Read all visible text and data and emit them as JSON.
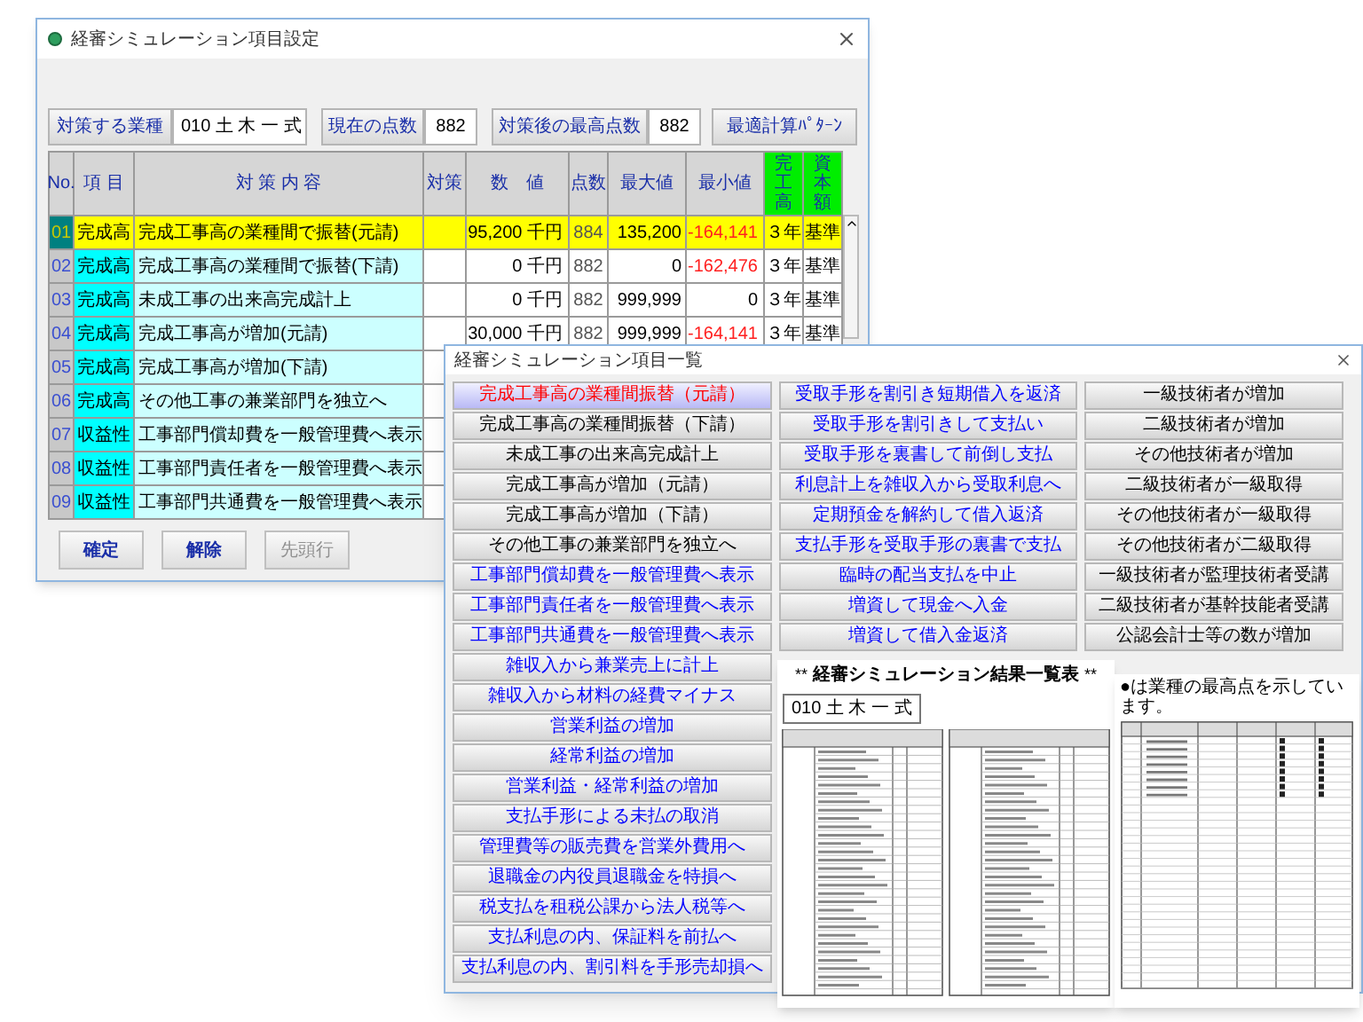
{
  "main_window": {
    "title": "経審シミュレーション項目設定",
    "toolbar": {
      "industry_label": "対策する業種",
      "industry_value": "010 土 木 一 式",
      "current_label": "現在の点数",
      "current_value": "882",
      "best_label": "対策後の最高点数",
      "best_value": "882",
      "pattern_button": "最適計算ﾊﾟﾀｰﾝ"
    },
    "columns": [
      {
        "label": "No.",
        "highlight": false
      },
      {
        "label": "項 目",
        "highlight": false
      },
      {
        "label": "対 策 内 容",
        "highlight": false
      },
      {
        "label": "対策",
        "highlight": false
      },
      {
        "label": "数　値",
        "highlight": false
      },
      {
        "label": "点数",
        "highlight": false
      },
      {
        "label": "最大値",
        "highlight": false
      },
      {
        "label": "最小値",
        "highlight": false
      },
      {
        "label": "完工高",
        "highlight": true
      },
      {
        "label": "資本額",
        "highlight": true
      }
    ],
    "rows": [
      {
        "no": "01",
        "category": "完成高",
        "measure": "完成工事高の業種間で振替(元請)",
        "value": "95,200 千円",
        "points": "884",
        "max": "135,200",
        "min": "-164,141",
        "min_alert": true,
        "years": "３年",
        "basis": "基準",
        "selected": true
      },
      {
        "no": "02",
        "category": "完成高",
        "measure": "完成工事高の業種間で振替(下請)",
        "value": "0 千円",
        "points": "882",
        "max": "0",
        "min": "-162,476",
        "min_alert": true,
        "years": "３年",
        "basis": "基準",
        "selected": false
      },
      {
        "no": "03",
        "category": "完成高",
        "measure": "未成工事の出来高完成計上",
        "value": "0 千円",
        "points": "882",
        "max": "999,999",
        "min": "0",
        "min_alert": false,
        "years": "３年",
        "basis": "基準",
        "selected": false
      },
      {
        "no": "04",
        "category": "完成高",
        "measure": "完成工事高が増加(元請)",
        "value": "30,000 千円",
        "points": "882",
        "max": "999,999",
        "min": "-164,141",
        "min_alert": true,
        "years": "３年",
        "basis": "基準",
        "selected": false
      },
      {
        "no": "05",
        "category": "完成高",
        "measure": "完成工事高が増加(下請)",
        "selected": false
      },
      {
        "no": "06",
        "category": "完成高",
        "measure": "その他工事の兼業部門を独立へ",
        "selected": false
      },
      {
        "no": "07",
        "category": "収益性",
        "measure": "工事部門償却費を一般管理費へ表示",
        "selected": false
      },
      {
        "no": "08",
        "category": "収益性",
        "measure": "工事部門責任者を一般管理費へ表示",
        "selected": false
      },
      {
        "no": "09",
        "category": "収益性",
        "measure": "工事部門共通費を一般管理費へ表示",
        "selected": false
      }
    ],
    "buttons": [
      {
        "label": "確定",
        "disabled": false
      },
      {
        "label": "解除",
        "disabled": false
      },
      {
        "label": "先頭行",
        "disabled": true
      }
    ]
  },
  "list_window": {
    "title": "経審シミュレーション項目一覧",
    "columns": [
      [
        {
          "label": "完成工事高の業種間振替（元請）",
          "color": "#ff0000",
          "selected": true
        },
        {
          "label": "完成工事高の業種間振替（下請）",
          "color": "#000000",
          "selected": false
        },
        {
          "label": "未成工事の出来高完成計上",
          "color": "#000000",
          "selected": false
        },
        {
          "label": "完成工事高が増加（元請）",
          "color": "#000000",
          "selected": false
        },
        {
          "label": "完成工事高が増加（下請）",
          "color": "#000000",
          "selected": false
        },
        {
          "label": "その他工事の兼業部門を独立へ",
          "color": "#000000",
          "selected": false
        },
        {
          "label": "工事部門償却費を一般管理費へ表示",
          "color": "#0000ff",
          "selected": false
        },
        {
          "label": "工事部門責任者を一般管理費へ表示",
          "color": "#0000ff",
          "selected": false
        },
        {
          "label": "工事部門共通費を一般管理費へ表示",
          "color": "#0000ff",
          "selected": false
        },
        {
          "label": "雑収入から兼業売上に計上",
          "color": "#0000ff",
          "selected": false
        },
        {
          "label": "雑収入から材料の経費マイナス",
          "color": "#0000ff",
          "selected": false
        },
        {
          "label": "営業利益の増加",
          "color": "#0000ff",
          "selected": false
        },
        {
          "label": "経常利益の増加",
          "color": "#0000ff",
          "selected": false
        },
        {
          "label": "営業利益・経常利益の増加",
          "color": "#0000ff",
          "selected": false
        },
        {
          "label": "支払手形による未払の取消",
          "color": "#0000ff",
          "selected": false
        },
        {
          "label": "管理費等の販売費を営業外費用へ",
          "color": "#0000ff",
          "selected": false
        },
        {
          "label": "退職金の内役員退職金を特損へ",
          "color": "#0000ff",
          "selected": false
        },
        {
          "label": "税支払を租税公課から法人税等へ",
          "color": "#0000ff",
          "selected": false
        },
        {
          "label": "支払利息の内、保証料を前払へ",
          "color": "#0000ff",
          "selected": false
        },
        {
          "label": "支払利息の内、割引料を手形売却損へ",
          "color": "#0000ff",
          "selected": false
        }
      ],
      [
        {
          "label": "受取手形を割引き短期借入を返済",
          "color": "#0000ff",
          "selected": false
        },
        {
          "label": "受取手形を割引きして支払い",
          "color": "#0000ff",
          "selected": false
        },
        {
          "label": "受取手形を裏書して前倒し支払",
          "color": "#0000ff",
          "selected": false
        },
        {
          "label": "利息計上を雑収入から受取利息へ",
          "color": "#0000ff",
          "selected": false
        },
        {
          "label": "定期預金を解約して借入返済",
          "color": "#0000ff",
          "selected": false
        },
        {
          "label": "支払手形を受取手形の裏書で支払",
          "color": "#0000ff",
          "selected": false
        },
        {
          "label": "臨時の配当支払を中止",
          "color": "#0000ff",
          "selected": false
        },
        {
          "label": "増資して現金へ入金",
          "color": "#0000ff",
          "selected": false
        },
        {
          "label": "増資して借入金返済",
          "color": "#0000ff",
          "selected": false
        }
      ],
      [
        {
          "label": "一級技術者が増加",
          "color": "#000000",
          "selected": false
        },
        {
          "label": "二級技術者が増加",
          "color": "#000000",
          "selected": false
        },
        {
          "label": "その他技術者が増加",
          "color": "#000000",
          "selected": false
        },
        {
          "label": "二級技術者が一級取得",
          "color": "#000000",
          "selected": false
        },
        {
          "label": "その他技術者が一級取得",
          "color": "#000000",
          "selected": false
        },
        {
          "label": "その他技術者が二級取得",
          "color": "#000000",
          "selected": false
        },
        {
          "label": "一級技術者が監理技術者受講",
          "color": "#000000",
          "selected": false
        },
        {
          "label": "二級技術者が基幹技能者受講",
          "color": "#000000",
          "selected": false
        },
        {
          "label": "公認会計士等の数が増加",
          "color": "#000000",
          "selected": false
        }
      ]
    ]
  },
  "report": {
    "mark_left": "**",
    "title": "経審シミュレーション結果一覧表",
    "mark_right": "**",
    "industry": "010 土 木 一 式"
  },
  "ranking_sheet": {
    "note": "●は業種の最高点を示しています。"
  }
}
